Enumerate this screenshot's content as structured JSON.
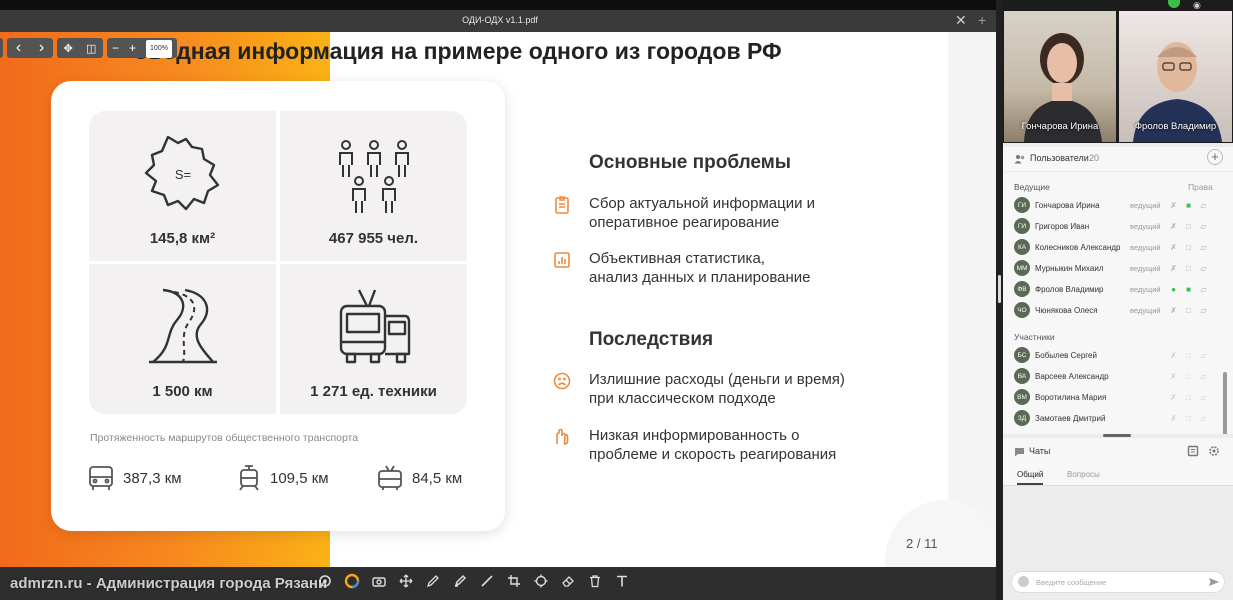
{
  "window": {
    "tab_title": "ОДИ-ОДХ v1.1.pdf",
    "close": "✕",
    "add": "+"
  },
  "viewer": {
    "zoom": "100%",
    "prev": "‹",
    "next": "›",
    "minus": "−",
    "plus": "+"
  },
  "slide": {
    "title": "Сводная информация на примере одного из городов РФ",
    "stats": [
      {
        "icon": "region-map-icon",
        "label": "145,8 км²",
        "icon_text": "S="
      },
      {
        "icon": "people-icon",
        "label": "467 955 чел."
      },
      {
        "icon": "road-icon",
        "label": "1 500 км"
      },
      {
        "icon": "trolleybus-icon",
        "label": "1 271 ед. техники"
      }
    ],
    "routes_caption": "Протяженность маршрутов общественного транспорта",
    "routes": [
      {
        "icon": "bus-icon",
        "value": "387,3 км"
      },
      {
        "icon": "tram-icon",
        "value": "109,5 км"
      },
      {
        "icon": "trolleybus-small-icon",
        "value": "84,5 км"
      }
    ],
    "problems_heading": "Основные проблемы",
    "problems": [
      {
        "icon": "clipboard-icon",
        "line1": "Сбор актуальной информации и",
        "line2": "оперативное реагирование"
      },
      {
        "icon": "chart-icon",
        "line1": "Объективная статистика,",
        "line2": "анализ данных и планирование"
      }
    ],
    "consequences_heading": "Последствия",
    "consequences": [
      {
        "icon": "sad-face-icon",
        "line1": "Излишние расходы (деньги и время)",
        "line2": "при классическом подходе"
      },
      {
        "icon": "hand-icon",
        "line1": "Низкая информированность о",
        "line2": "проблеме и скорость реагирования"
      }
    ],
    "page": "2 / 11"
  },
  "watermark": "admrzn.ru - Администрация города Рязани",
  "videos": [
    {
      "name": "Гончарова Ирина"
    },
    {
      "name": "Фролов Владимир"
    }
  ],
  "users": {
    "title": "Пользователи",
    "count": "20",
    "hosts_label": "Ведущие",
    "rights_label": "Права",
    "hosts": [
      {
        "initials": "ГИ",
        "name": "Гончарова Ирина",
        "role": "ведущий"
      },
      {
        "initials": "ГИ",
        "name": "Григоров Иван",
        "role": "ведущий"
      },
      {
        "initials": "КА",
        "name": "Колесников Александр",
        "role": "ведущий"
      },
      {
        "initials": "ММ",
        "name": "Мурныкин Михаил",
        "role": "ведущий"
      },
      {
        "initials": "ФВ",
        "name": "Фролов Владимир",
        "role": "ведущий"
      },
      {
        "initials": "ЧО",
        "name": "Чюнякова Олеся",
        "role": "ведущий"
      }
    ],
    "participants_label": "Участники",
    "participants": [
      {
        "initials": "БС",
        "name": "Бобылев Сергей"
      },
      {
        "initials": "ВА",
        "name": "Варсеев Александр"
      },
      {
        "initials": "ВМ",
        "name": "Воротилина Мария"
      },
      {
        "initials": "ЗД",
        "name": "Замотаев Дмитрий"
      }
    ]
  },
  "chat": {
    "title": "Чаты",
    "tab_general": "Общий",
    "tab_questions": "Вопросы",
    "placeholder": "Введите сообщение"
  },
  "colors": {
    "accent": "#f26a1b",
    "accent2": "#fbb216",
    "green": "#3cbf4a"
  }
}
